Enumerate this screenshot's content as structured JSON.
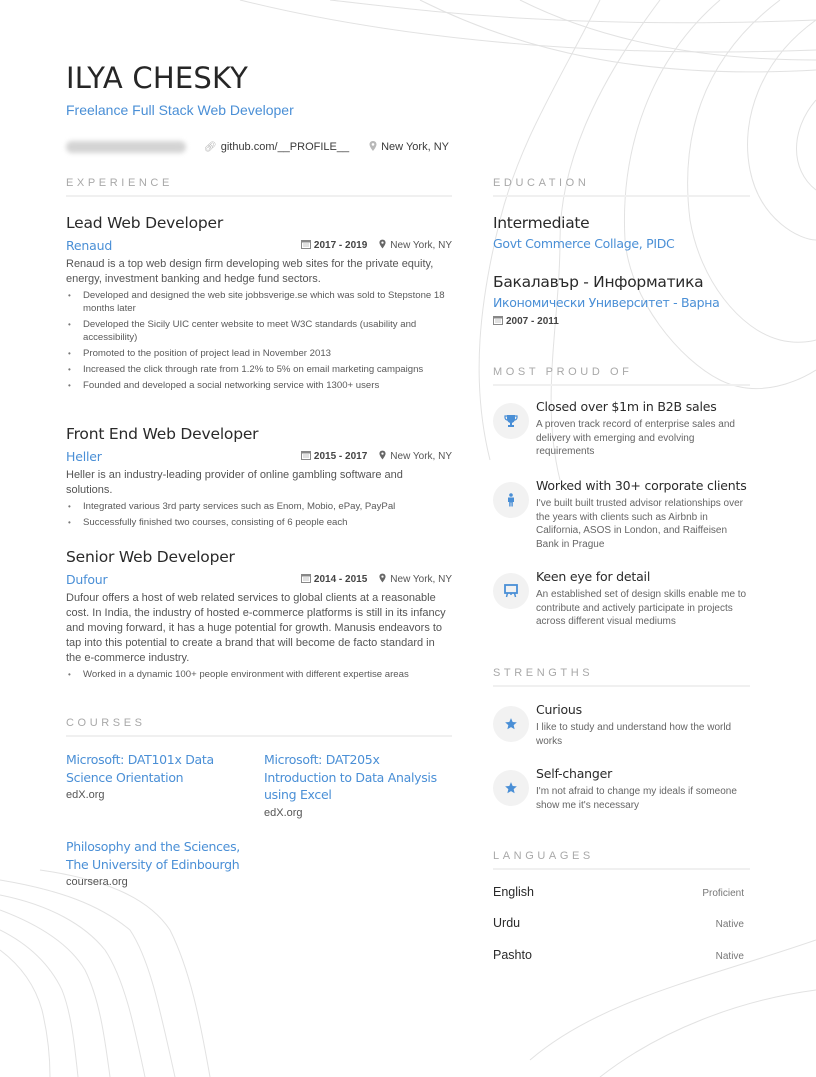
{
  "header": {
    "name": "ILYA CHESKY",
    "title": "Freelance Full Stack Web Developer",
    "email_icon": "at-icon",
    "link_icon": "link-icon",
    "link": "github.com/__PROFILE__",
    "location_icon": "map-pin-icon",
    "location": "New York, NY"
  },
  "sections": {
    "experience": "EXPERIENCE",
    "courses": "COURSES",
    "education": "EDUCATION",
    "proud": "MOST PROUD OF",
    "strengths": "STRENGTHS",
    "languages": "LANGUAGES"
  },
  "experience": [
    {
      "title": "Lead Web Developer",
      "company": "Renaud",
      "dates": "2017 - 2019",
      "location": "New York, NY",
      "description": "Renaud is a top web design firm developing web sites for the private equity, energy, investment banking and hedge fund sectors.",
      "bullets": [
        "Developed and designed the web site jobbsverige.se which was sold to Stepstone 18 months later",
        "Developed the Sicily UIC center website to meet W3C standards (usability and accessibility)",
        "Promoted to the position of project lead in November 2013",
        "Increased the click through rate from 1.2% to 5% on email marketing campaigns",
        "Founded and developed a social networking service with 1300+ users"
      ]
    },
    {
      "title": "Front End Web Developer",
      "company": "Heller",
      "dates": "2015 - 2017",
      "location": "New York, NY",
      "description": "Heller is an industry-leading provider of online gambling software and solutions.",
      "bullets": [
        "Integrated various 3rd party services such as Enom, Mobio, ePay, PayPal",
        "Successfully finished two courses, consisting of 6 people each"
      ]
    },
    {
      "title": "Senior Web Developer",
      "company": "Dufour",
      "dates": "2014 - 2015",
      "location": "New York, NY",
      "description": "Dufour offers a host of web related services to global clients at a reasonable cost. In India, the industry of hosted e-commerce platforms is still in its infancy and moving forward, it has a huge potential for growth. Manusis endeavors to tap into this potential to create a brand that will become de facto standard in the e-commerce industry.",
      "bullets": [
        "Worked in a dynamic 100+ people environment with different expertise areas"
      ]
    }
  ],
  "courses": [
    {
      "name": "Microsoft: DAT101x Data Science Orientation",
      "org": "edX.org"
    },
    {
      "name": "Microsoft: DAT205x Introduction to Data Analysis using Excel",
      "org": "edX.org"
    },
    {
      "name": "Philosophy and the Sciences, The University of Edinbourgh",
      "org": "coursera.org"
    }
  ],
  "education": [
    {
      "degree": "Intermediate",
      "school": "Govt Commerce Collage, PIDC"
    },
    {
      "degree": "Бакалавър - Информатика",
      "school": "Икономически Университет - Варна",
      "dates": "2007 - 2011"
    }
  ],
  "proud": [
    {
      "icon": "trophy-icon",
      "title": "Closed over $1m in B2B sales",
      "desc": "A proven track record of enterprise sales and delivery with emerging and evolving requirements"
    },
    {
      "icon": "person-icon",
      "title": "Worked with 30+ corporate clients",
      "desc": "I've built built trusted advisor relationships over the years with clients such as Airbnb in California, ASOS in London, and Raiffeisen Bank in Prague"
    },
    {
      "icon": "easel-icon",
      "title": "Keen eye for detail",
      "desc": "An established set of design skills enable me to contribute and actively participate in projects across different visual mediums"
    }
  ],
  "strengths": [
    {
      "icon": "star-icon",
      "title": "Curious",
      "desc": "I like to study and understand how the world works"
    },
    {
      "icon": "star-icon",
      "title": "Self-changer",
      "desc": "I'm not afraid to change my ideals if someone show me it's necessary"
    }
  ],
  "languages": [
    {
      "name": "English",
      "level": "Proficient"
    },
    {
      "name": "Urdu",
      "level": "Native"
    },
    {
      "name": "Pashto",
      "level": "Native"
    }
  ],
  "colors": {
    "accent": "#4a8fd6",
    "text": "#2a2a2a",
    "muted": "#a8a8a8"
  }
}
